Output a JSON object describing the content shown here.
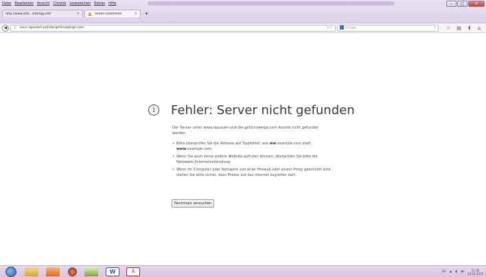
{
  "menu": [
    "Datei",
    "Bearbeiten",
    "Ansicht",
    "Chronik",
    "Lesezeichen",
    "Extras",
    "Hilfe"
  ],
  "tabs": [
    {
      "label": "http://www.anti...ietology.net/"
    },
    {
      "label": "Seiten-Ladefehler"
    }
  ],
  "tab_close_glyph": "×",
  "new_tab_glyph": "+",
  "navbar": {
    "url_prefix": "www.",
    "url_host": "rapunzel-und-die-gehirnzwerge.com",
    "search_placeholder": "Google"
  },
  "error": {
    "title": "Fehler: Server nicht gefunden",
    "description": "Der Server unter www.rapunzel-und-die-gehirnzwerge.com konnte nicht gefunden werden.",
    "bullets": [
      {
        "before": "Bitte überprüfen Sie die Adresse auf Tippfehler, wie ",
        "bold": "ww",
        "middle": ".example.com statt ",
        "bold2": "www",
        "after": ".example.com"
      },
      {
        "text": "Wenn Sie auch keine andere Website aufrufen können, überprüfen Sie bitte die Netzwerk-/Internetverbindung."
      },
      {
        "text": "Wenn Ihr Computer oder Netzwerk von einer Firewall oder einem Proxy geschützt wird, stellen Sie bitte sicher, dass Firefox auf das Internet zugreifen darf."
      }
    ],
    "retry_label": "Nochmals versuchen"
  },
  "taskbar": {
    "word_glyph": "W",
    "pdf_glyph": "⅄",
    "tray_lang": "DE",
    "clock_time": "21:36",
    "clock_date": "24.02.2015"
  },
  "icons": {
    "info": "info-circle-icon",
    "warning": "warning-triangle-icon"
  }
}
